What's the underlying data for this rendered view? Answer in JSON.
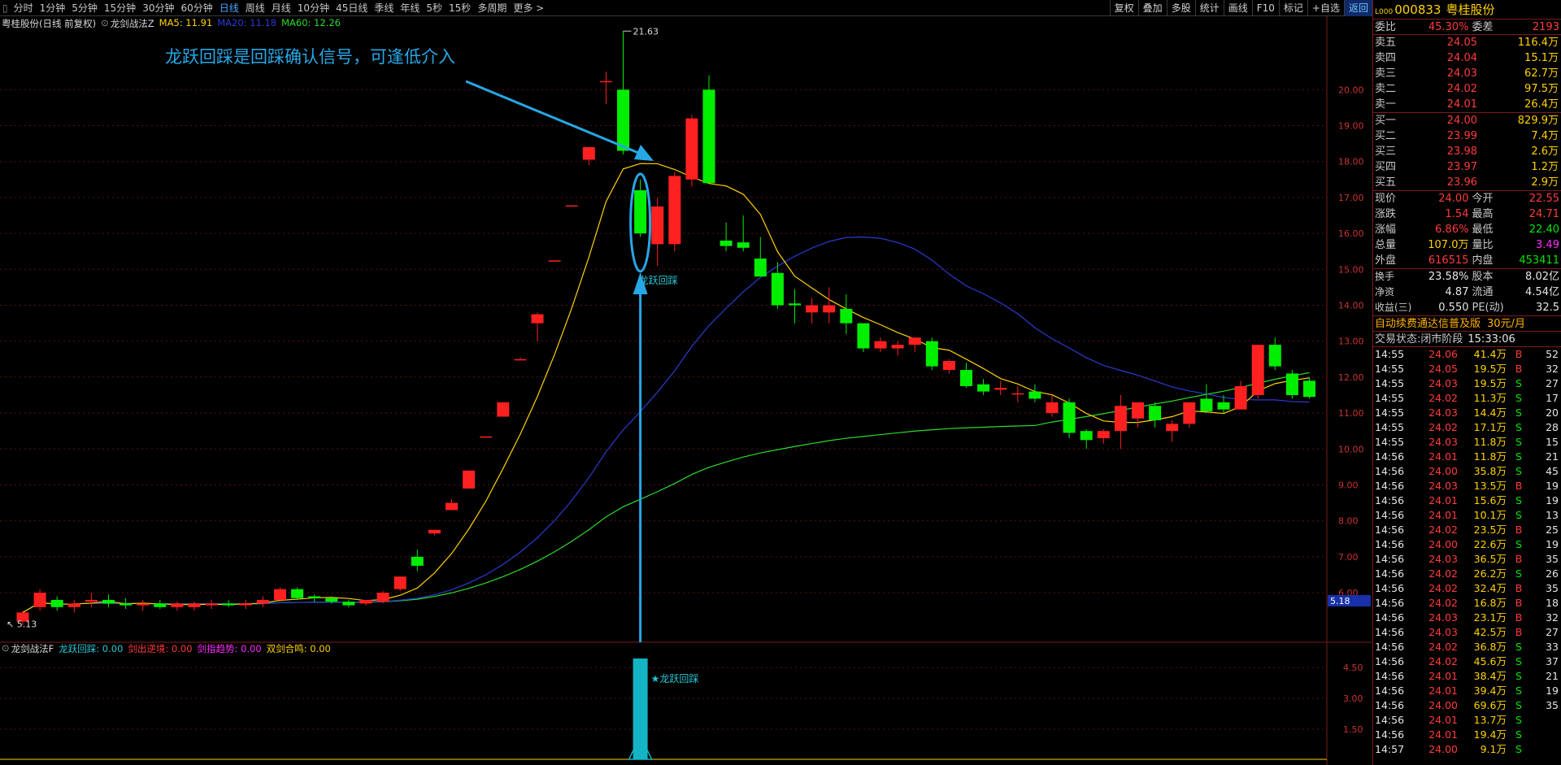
{
  "toolbar": {
    "periods": [
      "分时",
      "1分钟",
      "5分钟",
      "15分钟",
      "30分钟",
      "60分钟",
      "日线",
      "周线",
      "月线",
      "10分钟",
      "45日线",
      "季线",
      "年线",
      "5秒",
      "15秒",
      "多周期",
      "更多 >"
    ],
    "active": "日线",
    "right_buttons": [
      "复权",
      "叠加",
      "多股",
      "统计",
      "画线",
      "F10",
      "标记",
      "+自选",
      "返回"
    ]
  },
  "legend": {
    "stock": "粤桂股份(日线 前复权)",
    "indicator": "龙剑战法Z",
    "ma5": "MA5: 11.91",
    "ma20": "MA20: 11.18",
    "ma60": "MA60: 12.26"
  },
  "annotation": {
    "text": "龙跃回踩是回踩确认信号，可逢低介入",
    "marker_label": "龙跃回踩",
    "sub_marker_label": "★龙跃回踩"
  },
  "sub_legend": {
    "name": "龙剑战法F",
    "items": [
      {
        "label": "龙跃回踩: 0.00",
        "color": "#27c7d6"
      },
      {
        "label": "剑出逆境: 0.00",
        "color": "#ff3b3b"
      },
      {
        "label": "剑指趋势: 0.00",
        "color": "#ff2bff"
      },
      {
        "label": "双剑合鸣: 0.00",
        "color": "#ffd200"
      }
    ]
  },
  "chart_data": {
    "type": "candlestick",
    "y_axis": [
      "20.00",
      "19.00",
      "18.00",
      "17.00",
      "16.00",
      "15.00",
      "14.00",
      "13.00",
      "12.00",
      "11.00",
      "10.00",
      "9.00",
      "8.00",
      "7.00",
      "6.00"
    ],
    "sub_axis": [
      "4.50",
      "3.00",
      "1.50"
    ],
    "high_label": "21.63",
    "low_label": "5.13",
    "current_price_tag": "5.18",
    "candles": [
      {
        "o": 5.2,
        "h": 5.5,
        "l": 5.1,
        "c": 5.45
      },
      {
        "o": 5.6,
        "h": 6.1,
        "l": 5.5,
        "c": 6.0
      },
      {
        "o": 5.8,
        "h": 5.9,
        "l": 5.5,
        "c": 5.6
      },
      {
        "o": 5.6,
        "h": 5.8,
        "l": 5.45,
        "c": 5.7
      },
      {
        "o": 5.75,
        "h": 6.0,
        "l": 5.6,
        "c": 5.8
      },
      {
        "o": 5.8,
        "h": 5.95,
        "l": 5.6,
        "c": 5.7
      },
      {
        "o": 5.7,
        "h": 5.85,
        "l": 5.55,
        "c": 5.65
      },
      {
        "o": 5.65,
        "h": 5.8,
        "l": 5.5,
        "c": 5.7
      },
      {
        "o": 5.7,
        "h": 5.8,
        "l": 5.55,
        "c": 5.6
      },
      {
        "o": 5.6,
        "h": 5.75,
        "l": 5.5,
        "c": 5.7
      },
      {
        "o": 5.6,
        "h": 5.75,
        "l": 5.5,
        "c": 5.7
      },
      {
        "o": 5.65,
        "h": 5.8,
        "l": 5.55,
        "c": 5.7
      },
      {
        "o": 5.7,
        "h": 5.8,
        "l": 5.6,
        "c": 5.65
      },
      {
        "o": 5.65,
        "h": 5.8,
        "l": 5.55,
        "c": 5.7
      },
      {
        "o": 5.7,
        "h": 5.9,
        "l": 5.6,
        "c": 5.8
      },
      {
        "o": 5.8,
        "h": 6.15,
        "l": 5.75,
        "c": 6.1
      },
      {
        "o": 6.1,
        "h": 6.15,
        "l": 5.8,
        "c": 5.85
      },
      {
        "o": 5.9,
        "h": 5.95,
        "l": 5.75,
        "c": 5.85
      },
      {
        "o": 5.85,
        "h": 5.9,
        "l": 5.7,
        "c": 5.75
      },
      {
        "o": 5.75,
        "h": 5.8,
        "l": 5.6,
        "c": 5.65
      },
      {
        "o": 5.7,
        "h": 5.8,
        "l": 5.65,
        "c": 5.8
      },
      {
        "o": 5.75,
        "h": 6.05,
        "l": 5.7,
        "c": 6.0
      },
      {
        "o": 6.1,
        "h": 6.45,
        "l": 6.05,
        "c": 6.45
      },
      {
        "o": 7.0,
        "h": 7.2,
        "l": 6.6,
        "c": 6.75
      },
      {
        "o": 7.65,
        "h": 7.75,
        "l": 7.6,
        "c": 7.75
      },
      {
        "o": 8.3,
        "h": 8.6,
        "l": 8.3,
        "c": 8.5
      },
      {
        "o": 8.9,
        "h": 9.4,
        "l": 8.9,
        "c": 9.4
      },
      {
        "o": 10.35,
        "h": 10.35,
        "l": 10.35,
        "c": 10.35
      },
      {
        "o": 10.9,
        "h": 11.3,
        "l": 10.9,
        "c": 11.3
      },
      {
        "o": 12.5,
        "h": 12.55,
        "l": 12.5,
        "c": 12.5
      },
      {
        "o": 13.5,
        "h": 13.8,
        "l": 13.0,
        "c": 13.75
      },
      {
        "o": 15.25,
        "h": 15.25,
        "l": 15.25,
        "c": 15.25
      },
      {
        "o": 16.78,
        "h": 16.78,
        "l": 16.78,
        "c": 16.78
      },
      {
        "o": 18.05,
        "h": 18.4,
        "l": 17.9,
        "c": 18.4
      },
      {
        "o": 20.24,
        "h": 20.5,
        "l": 19.6,
        "c": 20.24
      },
      {
        "o": 20.0,
        "h": 21.63,
        "l": 18.2,
        "c": 18.3
      },
      {
        "o": 17.2,
        "h": 17.5,
        "l": 15.9,
        "c": 16.0
      },
      {
        "o": 15.7,
        "h": 17.0,
        "l": 15.1,
        "c": 16.75
      },
      {
        "o": 15.7,
        "h": 17.7,
        "l": 15.5,
        "c": 17.6
      },
      {
        "o": 17.5,
        "h": 19.3,
        "l": 17.3,
        "c": 19.2
      },
      {
        "o": 20.0,
        "h": 20.4,
        "l": 17.4,
        "c": 17.4
      },
      {
        "o": 15.8,
        "h": 16.3,
        "l": 15.5,
        "c": 15.65
      },
      {
        "o": 15.75,
        "h": 16.5,
        "l": 15.5,
        "c": 15.6
      },
      {
        "o": 15.3,
        "h": 15.9,
        "l": 14.8,
        "c": 14.8
      },
      {
        "o": 14.9,
        "h": 15.2,
        "l": 13.9,
        "c": 14.0
      },
      {
        "o": 14.05,
        "h": 14.45,
        "l": 13.5,
        "c": 14.0
      },
      {
        "o": 13.8,
        "h": 14.2,
        "l": 13.5,
        "c": 14.0
      },
      {
        "o": 13.8,
        "h": 14.5,
        "l": 13.5,
        "c": 14.0
      },
      {
        "o": 13.9,
        "h": 14.3,
        "l": 13.2,
        "c": 13.5
      },
      {
        "o": 13.5,
        "h": 13.5,
        "l": 12.7,
        "c": 12.8
      },
      {
        "o": 12.8,
        "h": 13.1,
        "l": 12.7,
        "c": 13.0
      },
      {
        "o": 12.8,
        "h": 13.0,
        "l": 12.6,
        "c": 12.9
      },
      {
        "o": 12.9,
        "h": 13.1,
        "l": 12.7,
        "c": 13.1
      },
      {
        "o": 13.0,
        "h": 13.1,
        "l": 12.2,
        "c": 12.3
      },
      {
        "o": 12.2,
        "h": 12.5,
        "l": 12.1,
        "c": 12.45
      },
      {
        "o": 12.2,
        "h": 12.4,
        "l": 11.7,
        "c": 11.75
      },
      {
        "o": 11.8,
        "h": 11.95,
        "l": 11.5,
        "c": 11.6
      },
      {
        "o": 11.65,
        "h": 11.9,
        "l": 11.5,
        "c": 11.7
      },
      {
        "o": 11.55,
        "h": 11.75,
        "l": 11.3,
        "c": 11.55
      },
      {
        "o": 11.6,
        "h": 11.8,
        "l": 11.3,
        "c": 11.4
      },
      {
        "o": 11.0,
        "h": 11.5,
        "l": 10.9,
        "c": 11.3
      },
      {
        "o": 11.3,
        "h": 11.4,
        "l": 10.3,
        "c": 10.45
      },
      {
        "o": 10.5,
        "h": 10.55,
        "l": 10.0,
        "c": 10.25
      },
      {
        "o": 10.3,
        "h": 10.55,
        "l": 10.15,
        "c": 10.5
      },
      {
        "o": 10.5,
        "h": 11.5,
        "l": 10.0,
        "c": 11.2
      },
      {
        "o": 10.85,
        "h": 11.3,
        "l": 10.6,
        "c": 11.3
      },
      {
        "o": 11.2,
        "h": 11.3,
        "l": 10.6,
        "c": 10.8
      },
      {
        "o": 10.5,
        "h": 10.8,
        "l": 10.2,
        "c": 10.7
      },
      {
        "o": 10.7,
        "h": 11.3,
        "l": 10.6,
        "c": 11.3
      },
      {
        "o": 11.4,
        "h": 11.8,
        "l": 11.0,
        "c": 11.05
      },
      {
        "o": 11.3,
        "h": 11.5,
        "l": 11.0,
        "c": 11.1
      },
      {
        "o": 11.1,
        "h": 11.9,
        "l": 11.1,
        "c": 11.75
      },
      {
        "o": 11.5,
        "h": 12.9,
        "l": 11.4,
        "c": 12.9
      },
      {
        "o": 12.9,
        "h": 13.1,
        "l": 12.2,
        "c": 12.3
      },
      {
        "o": 12.1,
        "h": 12.2,
        "l": 11.4,
        "c": 11.5
      },
      {
        "o": 11.9,
        "h": 12.0,
        "l": 11.4,
        "c": 11.45
      }
    ]
  },
  "right_panel": {
    "code": "000833",
    "name": "粤桂股份",
    "wb_label": "委比",
    "wb_val": "45.30%",
    "wc_label": "委差",
    "wc_val": "2193",
    "sells": [
      {
        "label": "卖五",
        "price": "24.05",
        "vol": "116.4万"
      },
      {
        "label": "卖四",
        "price": "24.04",
        "vol": "15.1万"
      },
      {
        "label": "卖三",
        "price": "24.03",
        "vol": "62.7万"
      },
      {
        "label": "卖二",
        "price": "24.02",
        "vol": "97.5万"
      },
      {
        "label": "卖一",
        "price": "24.01",
        "vol": "26.4万"
      }
    ],
    "buys": [
      {
        "label": "买一",
        "price": "24.00",
        "vol": "829.9万"
      },
      {
        "label": "买二",
        "price": "23.99",
        "vol": "7.4万"
      },
      {
        "label": "买三",
        "price": "23.98",
        "vol": "2.6万"
      },
      {
        "label": "买四",
        "price": "23.97",
        "vol": "1.2万"
      },
      {
        "label": "买五",
        "price": "23.96",
        "vol": "2.9万"
      }
    ],
    "stats": [
      {
        "l1": "现价",
        "v1": "24.00",
        "c1": "red",
        "l2": "今开",
        "v2": "22.55",
        "c2": "red"
      },
      {
        "l1": "涨跌",
        "v1": "1.54",
        "c1": "red",
        "l2": "最高",
        "v2": "24.71",
        "c2": "red"
      },
      {
        "l1": "涨幅",
        "v1": "6.86%",
        "c1": "red",
        "l2": "最低",
        "v2": "22.40",
        "c2": "green"
      },
      {
        "l1": "总量",
        "v1": "107.0万",
        "c1": "yel",
        "l2": "量比",
        "v2": "3.49",
        "c2": "mag"
      },
      {
        "l1": "外盘",
        "v1": "616515",
        "c1": "red",
        "l2": "内盘",
        "v2": "453411",
        "c2": "green"
      }
    ],
    "stats2": [
      {
        "l1": "换手",
        "v1": "23.58%",
        "l2": "股本",
        "v2": "8.02亿"
      },
      {
        "l1": "净资",
        "v1": "4.87",
        "l2": "流通",
        "v2": "4.54亿"
      },
      {
        "l1": "收益(三)",
        "v1": "0.550",
        "l2": "PE(动)",
        "v2": "32.5"
      }
    ],
    "ad": "自动续费通达信普及版",
    "ad_price": "30元/月",
    "status": "交易状态:闭市阶段",
    "status_time": "15:33:06",
    "ticks": [
      [
        "14:55",
        "24.06",
        "41.4万",
        "B",
        "52"
      ],
      [
        "14:55",
        "24.05",
        "19.5万",
        "B",
        "32"
      ],
      [
        "14:55",
        "24.03",
        "19.5万",
        "S",
        "27"
      ],
      [
        "14:55",
        "24.02",
        "11.3万",
        "S",
        "17"
      ],
      [
        "14:55",
        "24.03",
        "14.4万",
        "S",
        "20"
      ],
      [
        "14:55",
        "24.02",
        "17.1万",
        "S",
        "28"
      ],
      [
        "14:55",
        "24.03",
        "11.8万",
        "S",
        "15"
      ],
      [
        "14:56",
        "24.01",
        "11.8万",
        "S",
        "21"
      ],
      [
        "14:56",
        "24.00",
        "35.8万",
        "S",
        "45"
      ],
      [
        "14:56",
        "24.03",
        "13.5万",
        "B",
        "19"
      ],
      [
        "14:56",
        "24.01",
        "15.6万",
        "S",
        "19"
      ],
      [
        "14:56",
        "24.01",
        "10.1万",
        "S",
        "13"
      ],
      [
        "14:56",
        "24.02",
        "23.5万",
        "B",
        "25"
      ],
      [
        "14:56",
        "24.00",
        "22.6万",
        "S",
        "19"
      ],
      [
        "14:56",
        "24.03",
        "36.5万",
        "B",
        "35"
      ],
      [
        "14:56",
        "24.02",
        "26.2万",
        "S",
        "26"
      ],
      [
        "14:56",
        "24.02",
        "32.4万",
        "B",
        "35"
      ],
      [
        "14:56",
        "24.02",
        "16.8万",
        "B",
        "18"
      ],
      [
        "14:56",
        "24.03",
        "23.1万",
        "B",
        "32"
      ],
      [
        "14:56",
        "24.03",
        "42.5万",
        "B",
        "27"
      ],
      [
        "14:56",
        "24.02",
        "36.8万",
        "S",
        "33"
      ],
      [
        "14:56",
        "24.02",
        "45.6万",
        "S",
        "37"
      ],
      [
        "14:56",
        "24.01",
        "38.4万",
        "S",
        "21"
      ],
      [
        "14:56",
        "24.01",
        "39.4万",
        "S",
        "19"
      ],
      [
        "14:56",
        "24.00",
        "69.6万",
        "S",
        "35"
      ],
      [
        "14:56",
        "24.01",
        "13.7万",
        "S",
        ""
      ],
      [
        "14:56",
        "24.01",
        "19.4万",
        "S",
        ""
      ],
      [
        "14:57",
        "24.00",
        "9.1万",
        "S",
        ""
      ]
    ]
  }
}
